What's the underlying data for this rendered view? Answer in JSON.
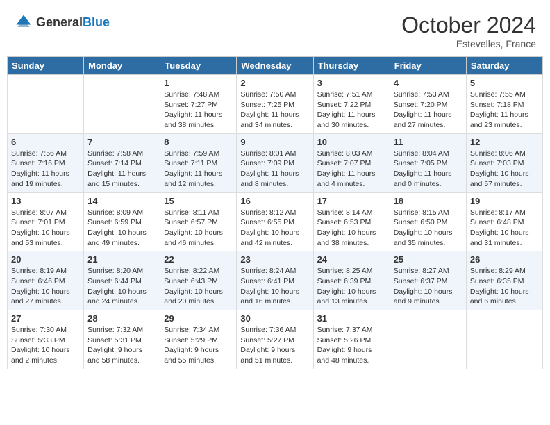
{
  "header": {
    "logo_general": "General",
    "logo_blue": "Blue",
    "month_title": "October 2024",
    "subtitle": "Estevelles, France"
  },
  "days_of_week": [
    "Sunday",
    "Monday",
    "Tuesday",
    "Wednesday",
    "Thursday",
    "Friday",
    "Saturday"
  ],
  "weeks": [
    [
      {
        "day": "",
        "sunrise": "",
        "sunset": "",
        "daylight": ""
      },
      {
        "day": "",
        "sunrise": "",
        "sunset": "",
        "daylight": ""
      },
      {
        "day": "1",
        "sunrise": "Sunrise: 7:48 AM",
        "sunset": "Sunset: 7:27 PM",
        "daylight": "Daylight: 11 hours and 38 minutes."
      },
      {
        "day": "2",
        "sunrise": "Sunrise: 7:50 AM",
        "sunset": "Sunset: 7:25 PM",
        "daylight": "Daylight: 11 hours and 34 minutes."
      },
      {
        "day": "3",
        "sunrise": "Sunrise: 7:51 AM",
        "sunset": "Sunset: 7:22 PM",
        "daylight": "Daylight: 11 hours and 30 minutes."
      },
      {
        "day": "4",
        "sunrise": "Sunrise: 7:53 AM",
        "sunset": "Sunset: 7:20 PM",
        "daylight": "Daylight: 11 hours and 27 minutes."
      },
      {
        "day": "5",
        "sunrise": "Sunrise: 7:55 AM",
        "sunset": "Sunset: 7:18 PM",
        "daylight": "Daylight: 11 hours and 23 minutes."
      }
    ],
    [
      {
        "day": "6",
        "sunrise": "Sunrise: 7:56 AM",
        "sunset": "Sunset: 7:16 PM",
        "daylight": "Daylight: 11 hours and 19 minutes."
      },
      {
        "day": "7",
        "sunrise": "Sunrise: 7:58 AM",
        "sunset": "Sunset: 7:14 PM",
        "daylight": "Daylight: 11 hours and 15 minutes."
      },
      {
        "day": "8",
        "sunrise": "Sunrise: 7:59 AM",
        "sunset": "Sunset: 7:11 PM",
        "daylight": "Daylight: 11 hours and 12 minutes."
      },
      {
        "day": "9",
        "sunrise": "Sunrise: 8:01 AM",
        "sunset": "Sunset: 7:09 PM",
        "daylight": "Daylight: 11 hours and 8 minutes."
      },
      {
        "day": "10",
        "sunrise": "Sunrise: 8:03 AM",
        "sunset": "Sunset: 7:07 PM",
        "daylight": "Daylight: 11 hours and 4 minutes."
      },
      {
        "day": "11",
        "sunrise": "Sunrise: 8:04 AM",
        "sunset": "Sunset: 7:05 PM",
        "daylight": "Daylight: 11 hours and 0 minutes."
      },
      {
        "day": "12",
        "sunrise": "Sunrise: 8:06 AM",
        "sunset": "Sunset: 7:03 PM",
        "daylight": "Daylight: 10 hours and 57 minutes."
      }
    ],
    [
      {
        "day": "13",
        "sunrise": "Sunrise: 8:07 AM",
        "sunset": "Sunset: 7:01 PM",
        "daylight": "Daylight: 10 hours and 53 minutes."
      },
      {
        "day": "14",
        "sunrise": "Sunrise: 8:09 AM",
        "sunset": "Sunset: 6:59 PM",
        "daylight": "Daylight: 10 hours and 49 minutes."
      },
      {
        "day": "15",
        "sunrise": "Sunrise: 8:11 AM",
        "sunset": "Sunset: 6:57 PM",
        "daylight": "Daylight: 10 hours and 46 minutes."
      },
      {
        "day": "16",
        "sunrise": "Sunrise: 8:12 AM",
        "sunset": "Sunset: 6:55 PM",
        "daylight": "Daylight: 10 hours and 42 minutes."
      },
      {
        "day": "17",
        "sunrise": "Sunrise: 8:14 AM",
        "sunset": "Sunset: 6:53 PM",
        "daylight": "Daylight: 10 hours and 38 minutes."
      },
      {
        "day": "18",
        "sunrise": "Sunrise: 8:15 AM",
        "sunset": "Sunset: 6:50 PM",
        "daylight": "Daylight: 10 hours and 35 minutes."
      },
      {
        "day": "19",
        "sunrise": "Sunrise: 8:17 AM",
        "sunset": "Sunset: 6:48 PM",
        "daylight": "Daylight: 10 hours and 31 minutes."
      }
    ],
    [
      {
        "day": "20",
        "sunrise": "Sunrise: 8:19 AM",
        "sunset": "Sunset: 6:46 PM",
        "daylight": "Daylight: 10 hours and 27 minutes."
      },
      {
        "day": "21",
        "sunrise": "Sunrise: 8:20 AM",
        "sunset": "Sunset: 6:44 PM",
        "daylight": "Daylight: 10 hours and 24 minutes."
      },
      {
        "day": "22",
        "sunrise": "Sunrise: 8:22 AM",
        "sunset": "Sunset: 6:43 PM",
        "daylight": "Daylight: 10 hours and 20 minutes."
      },
      {
        "day": "23",
        "sunrise": "Sunrise: 8:24 AM",
        "sunset": "Sunset: 6:41 PM",
        "daylight": "Daylight: 10 hours and 16 minutes."
      },
      {
        "day": "24",
        "sunrise": "Sunrise: 8:25 AM",
        "sunset": "Sunset: 6:39 PM",
        "daylight": "Daylight: 10 hours and 13 minutes."
      },
      {
        "day": "25",
        "sunrise": "Sunrise: 8:27 AM",
        "sunset": "Sunset: 6:37 PM",
        "daylight": "Daylight: 10 hours and 9 minutes."
      },
      {
        "day": "26",
        "sunrise": "Sunrise: 8:29 AM",
        "sunset": "Sunset: 6:35 PM",
        "daylight": "Daylight: 10 hours and 6 minutes."
      }
    ],
    [
      {
        "day": "27",
        "sunrise": "Sunrise: 7:30 AM",
        "sunset": "Sunset: 5:33 PM",
        "daylight": "Daylight: 10 hours and 2 minutes."
      },
      {
        "day": "28",
        "sunrise": "Sunrise: 7:32 AM",
        "sunset": "Sunset: 5:31 PM",
        "daylight": "Daylight: 9 hours and 58 minutes."
      },
      {
        "day": "29",
        "sunrise": "Sunrise: 7:34 AM",
        "sunset": "Sunset: 5:29 PM",
        "daylight": "Daylight: 9 hours and 55 minutes."
      },
      {
        "day": "30",
        "sunrise": "Sunrise: 7:36 AM",
        "sunset": "Sunset: 5:27 PM",
        "daylight": "Daylight: 9 hours and 51 minutes."
      },
      {
        "day": "31",
        "sunrise": "Sunrise: 7:37 AM",
        "sunset": "Sunset: 5:26 PM",
        "daylight": "Daylight: 9 hours and 48 minutes."
      },
      {
        "day": "",
        "sunrise": "",
        "sunset": "",
        "daylight": ""
      },
      {
        "day": "",
        "sunrise": "",
        "sunset": "",
        "daylight": ""
      }
    ]
  ]
}
